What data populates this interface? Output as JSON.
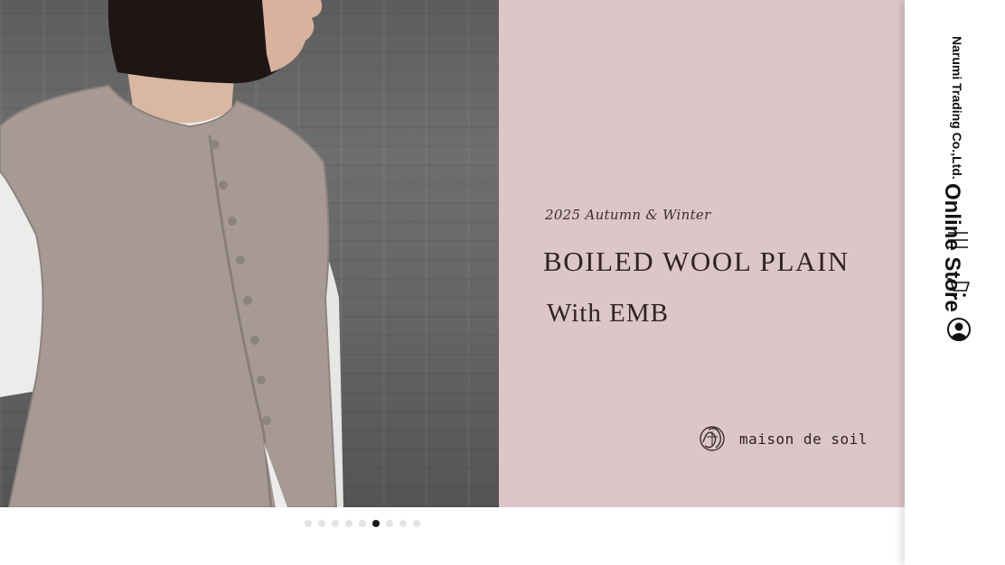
{
  "hero": {
    "season": "2025 Autumn & Winter",
    "headline": "BOILED WOOL PLAIN",
    "subline": "With EMB",
    "brand": "maison de soil",
    "panel_color": "#dbc6c8"
  },
  "slider": {
    "total_slides": 9,
    "active_index": 5
  },
  "sidebar": {
    "company": "Narumi Trading Co.,Ltd.",
    "store_name": "Online Store",
    "icons": [
      "menu-icon",
      "cart-icon",
      "account-icon"
    ]
  }
}
